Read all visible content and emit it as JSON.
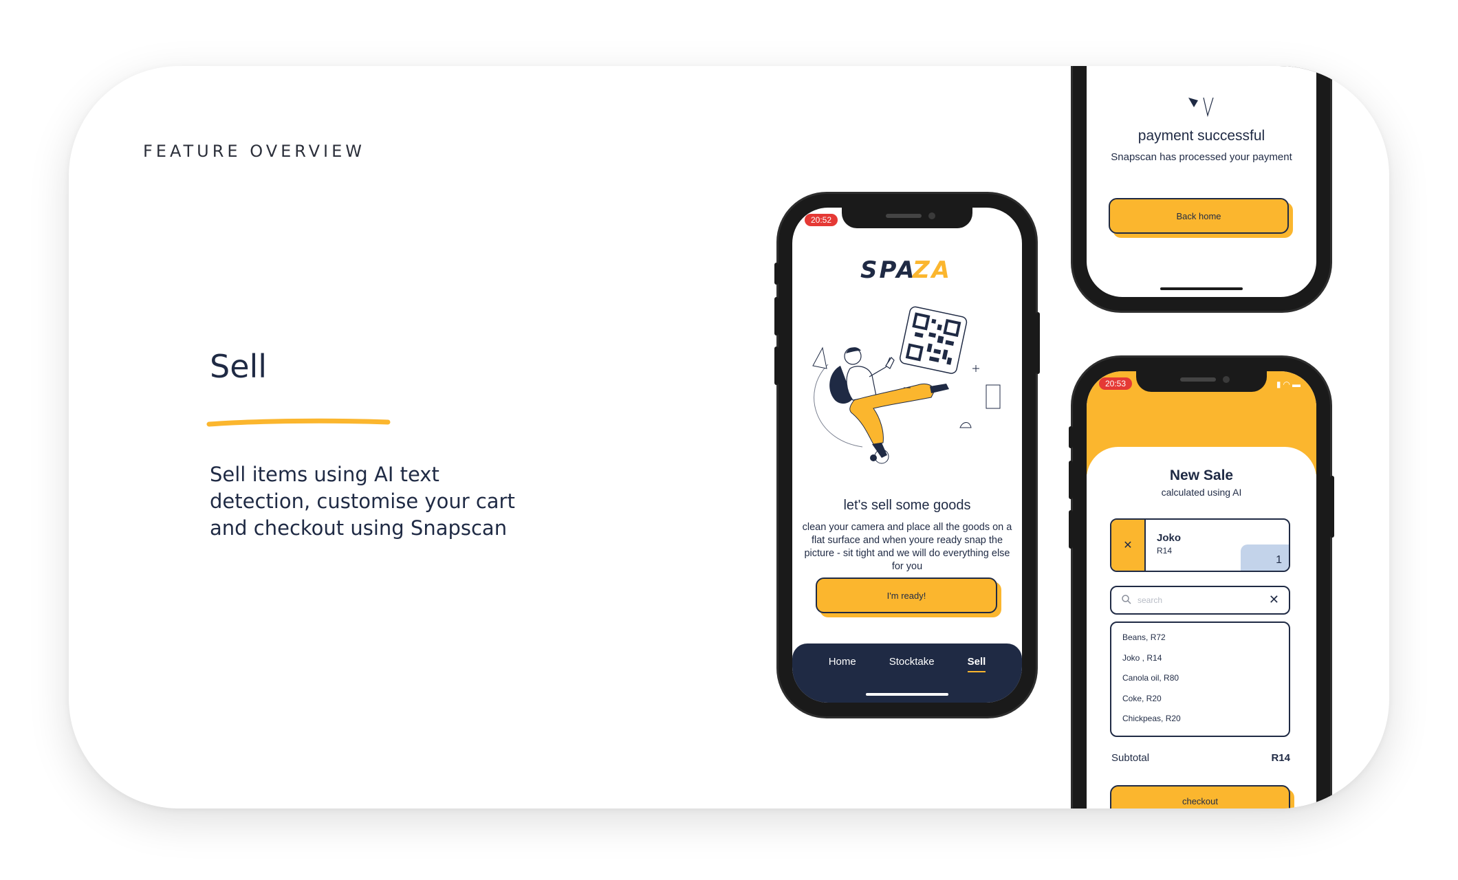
{
  "overview": {
    "eyebrow": "FEATURE OVERVIEW",
    "title": "Sell",
    "description": "Sell items using AI text detection, customise your cart and checkout using Snapscan",
    "accent_color": "#fbb62e",
    "text_color": "#1f2a44"
  },
  "phone_sell": {
    "time": "20:52",
    "logo": {
      "text": "SPAZA",
      "colors": [
        "#1f2a44",
        "#fbb62e"
      ]
    },
    "illustration": "person-scanning-qr-code",
    "heading": "let's sell some goods",
    "body": "clean your camera and place all the goods on a flat surface and when youre ready snap the picture - sit tight and we will do everything else for you",
    "ready_button": "I'm ready!",
    "nav": [
      {
        "label": "Home",
        "active": false
      },
      {
        "label": "Stocktake",
        "active": false
      },
      {
        "label": "Sell",
        "active": true
      }
    ]
  },
  "phone_payment": {
    "title": "payment successful",
    "subtitle": "Snapscan has processed your payment",
    "back_button": "Back home"
  },
  "phone_new_sale": {
    "time": "20:53",
    "title": "New Sale",
    "subtitle": "calculated using AI",
    "cart_item": {
      "name": "Joko",
      "price": "R14",
      "qty": "1",
      "remove_icon": "close-icon"
    },
    "search": {
      "placeholder": "search",
      "value": ""
    },
    "products": [
      "Beans, R72",
      "Joko , R14",
      "Canola oil, R80",
      "Coke, R20",
      "Chickpeas, R20"
    ],
    "subtotal_label": "Subtotal",
    "subtotal_value": "R14",
    "checkout_button": "checkout"
  }
}
